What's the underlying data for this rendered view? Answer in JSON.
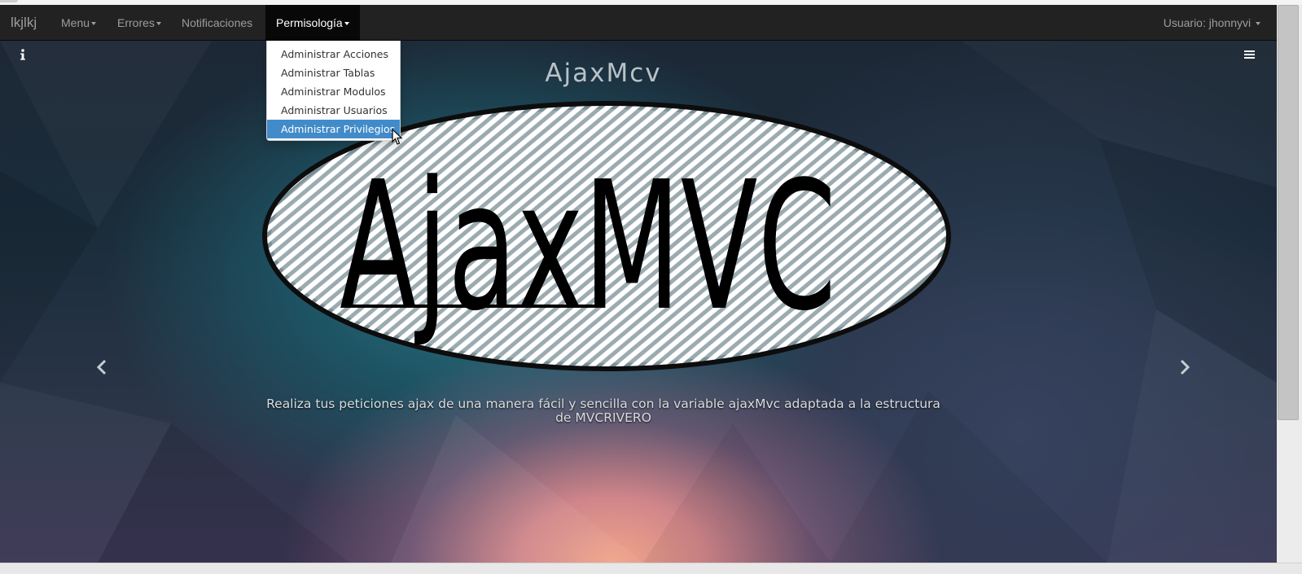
{
  "navbar": {
    "brand": "lkjlkj",
    "items": [
      {
        "label": "Menu",
        "dropdown": true
      },
      {
        "label": "Errores",
        "dropdown": true
      },
      {
        "label": "Notificaciones",
        "dropdown": false
      },
      {
        "label": "Permisología",
        "dropdown": true,
        "open": true
      }
    ],
    "user_label": "Usuario: jhonnyvi"
  },
  "dropdown": {
    "items": [
      {
        "label": "Administrar Acciones"
      },
      {
        "label": "Administrar Tablas"
      },
      {
        "label": "Administrar Modulos"
      },
      {
        "label": "Administrar Usuarios"
      },
      {
        "label": "Administrar Privilegios",
        "highlighted": true
      }
    ]
  },
  "carousel": {
    "title": "AjaxMcv",
    "logo_text": "AjaxMVC",
    "caption": "Realiza tus peticiones ajax de una manera fácil y sencilla con la variable ajaxMvc adaptada a la estructura de MVCRIVERO",
    "prev_icon": "chevron-left-icon",
    "next_icon": "chevron-right-icon"
  },
  "icons": {
    "info": "info-icon",
    "menu": "hamburger-icon"
  },
  "colors": {
    "navbar_bg": "#222222",
    "navbar_text": "#9d9d9d",
    "active_item_bg": "#428bca"
  }
}
